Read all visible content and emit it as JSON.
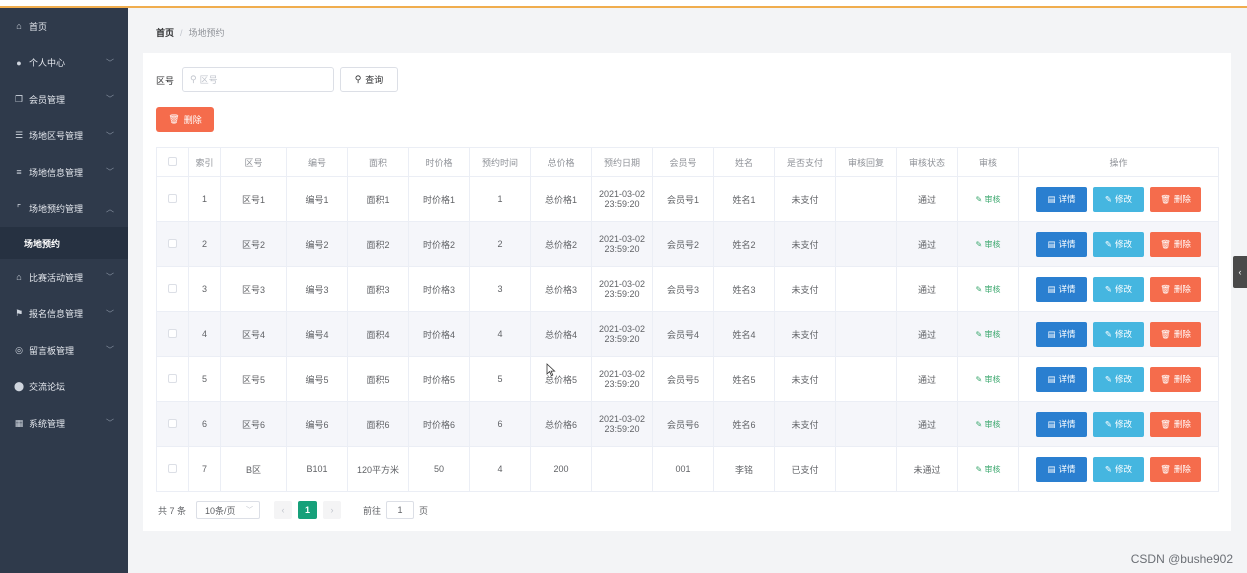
{
  "sidebar": {
    "items": [
      {
        "label": "首页",
        "icon": "home-icon"
      },
      {
        "label": "个人中心",
        "icon": "user-icon"
      },
      {
        "label": "会员管理",
        "icon": "copy-icon"
      },
      {
        "label": "场地区号管理",
        "icon": "sliders-icon"
      },
      {
        "label": "场地信息管理",
        "icon": "list-icon"
      },
      {
        "label": "场地预约管理",
        "icon": "crop-icon"
      },
      {
        "label": "场地预约",
        "icon": ""
      },
      {
        "label": "比赛活动管理",
        "icon": "bank-icon"
      },
      {
        "label": "报名信息管理",
        "icon": "flag-icon"
      },
      {
        "label": "留言板管理",
        "icon": "compass-icon"
      },
      {
        "label": "交流论坛",
        "icon": "location-icon"
      },
      {
        "label": "系统管理",
        "icon": "grid-icon"
      }
    ]
  },
  "breadcrumb": {
    "home": "首页",
    "separator": "/",
    "current": "场地预约"
  },
  "search": {
    "label": "区号",
    "placeholder": "区号",
    "button": "查询"
  },
  "toolbar": {
    "delete_label": "删除"
  },
  "table": {
    "headers": [
      "索引",
      "区号",
      "编号",
      "面积",
      "时价格",
      "预约时间",
      "总价格",
      "预约日期",
      "会员号",
      "姓名",
      "是否支付",
      "审核回复",
      "审核状态",
      "审核",
      "操作"
    ],
    "rows": [
      {
        "index": "1",
        "zone": "区号1",
        "code": "编号1",
        "area": "面积1",
        "price": "时价格1",
        "time": "1",
        "total": "总价格1",
        "date": "2021-03-02 23:59:20",
        "member": "会员号1",
        "name": "姓名1",
        "paid": "未支付",
        "reply": "",
        "status": "通过"
      },
      {
        "index": "2",
        "zone": "区号2",
        "code": "编号2",
        "area": "面积2",
        "price": "时价格2",
        "time": "2",
        "total": "总价格2",
        "date": "2021-03-02 23:59:20",
        "member": "会员号2",
        "name": "姓名2",
        "paid": "未支付",
        "reply": "",
        "status": "通过"
      },
      {
        "index": "3",
        "zone": "区号3",
        "code": "编号3",
        "area": "面积3",
        "price": "时价格3",
        "time": "3",
        "total": "总价格3",
        "date": "2021-03-02 23:59:20",
        "member": "会员号3",
        "name": "姓名3",
        "paid": "未支付",
        "reply": "",
        "status": "通过"
      },
      {
        "index": "4",
        "zone": "区号4",
        "code": "编号4",
        "area": "面积4",
        "price": "时价格4",
        "time": "4",
        "total": "总价格4",
        "date": "2021-03-02 23:59:20",
        "member": "会员号4",
        "name": "姓名4",
        "paid": "未支付",
        "reply": "",
        "status": "通过"
      },
      {
        "index": "5",
        "zone": "区号5",
        "code": "编号5",
        "area": "面积5",
        "price": "时价格5",
        "time": "5",
        "total": "总价格5",
        "date": "2021-03-02 23:59:20",
        "member": "会员号5",
        "name": "姓名5",
        "paid": "未支付",
        "reply": "",
        "status": "通过"
      },
      {
        "index": "6",
        "zone": "区号6",
        "code": "编号6",
        "area": "面积6",
        "price": "时价格6",
        "time": "6",
        "total": "总价格6",
        "date": "2021-03-02 23:59:20",
        "member": "会员号6",
        "name": "姓名6",
        "paid": "未支付",
        "reply": "",
        "status": "通过"
      },
      {
        "index": "7",
        "zone": "B区",
        "code": "B101",
        "area": "120平方米",
        "price": "50",
        "time": "4",
        "total": "200",
        "date": "",
        "member": "001",
        "name": "李铭",
        "paid": "已支付",
        "reply": "",
        "status": "未通过"
      }
    ],
    "audit_label": "审核",
    "actions": {
      "detail": "详情",
      "edit": "修改",
      "delete": "删除"
    }
  },
  "pagination": {
    "total": "共 7 条",
    "page_size": "10条/页",
    "current_page": "1",
    "goto_prefix": "前往",
    "goto_value": "1",
    "goto_suffix": "页"
  },
  "watermark": "CSDN @bushe902",
  "colors": {
    "sidebar_bg": "#2f3a4b",
    "danger": "#f56c4c",
    "primary": "#2a7fd0",
    "info": "#45b6e0",
    "success": "#16a07a"
  }
}
